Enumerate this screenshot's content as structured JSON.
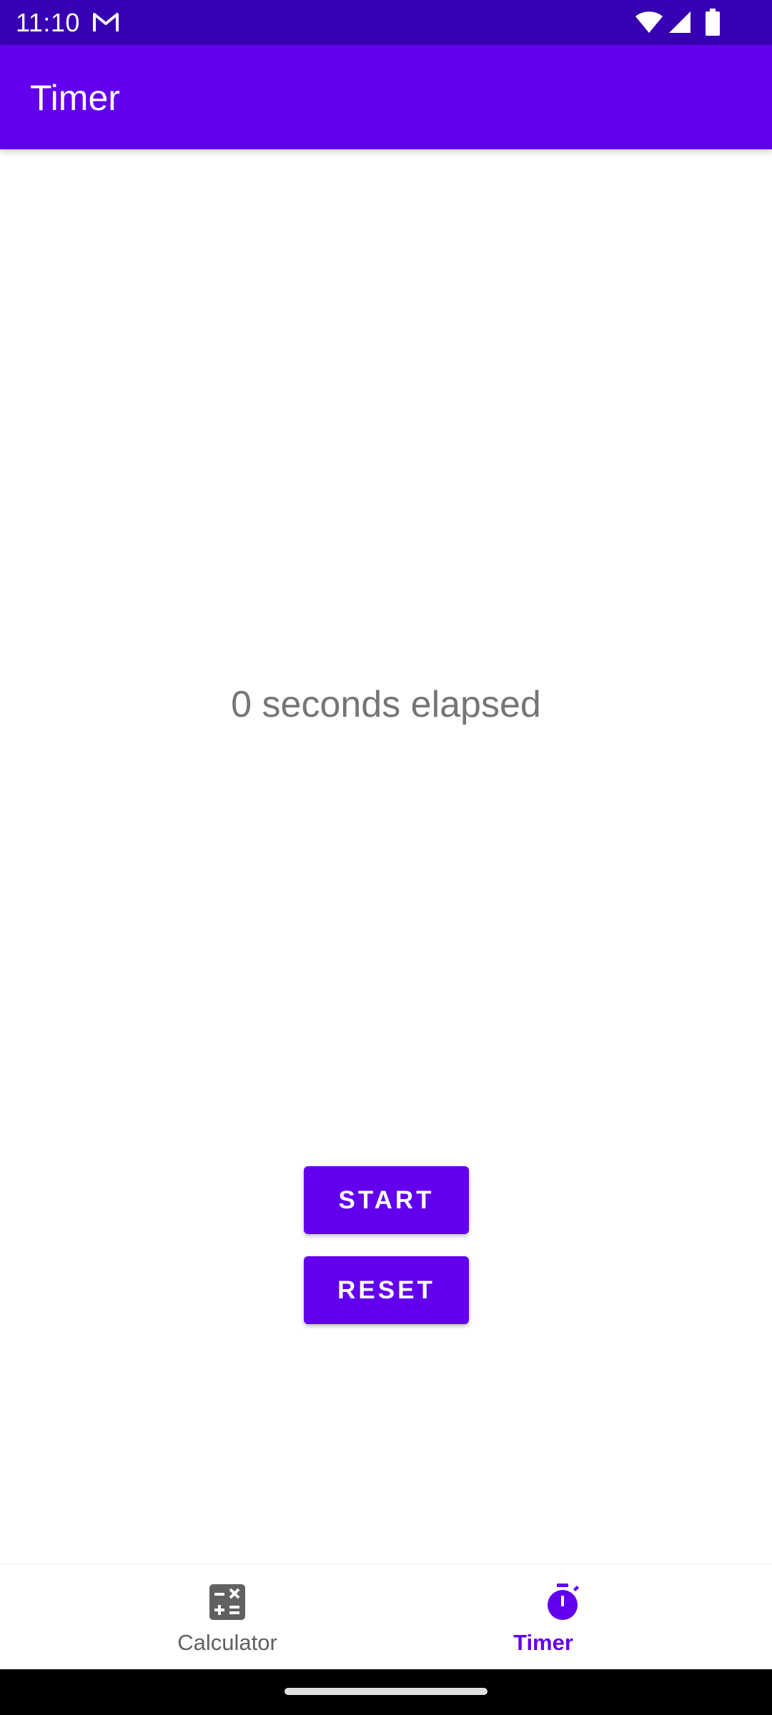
{
  "status_bar": {
    "time": "11:10",
    "icons": [
      "gmail-icon",
      "wifi-icon",
      "signal-icon",
      "battery-icon"
    ],
    "background_color": "#3700b3"
  },
  "app_bar": {
    "title": "Timer",
    "background_color": "#6200ee"
  },
  "timer": {
    "elapsed_text": "0 seconds elapsed"
  },
  "buttons": {
    "start_label": "START",
    "reset_label": "RESET",
    "color": "#6200ee"
  },
  "bottom_nav": {
    "items": [
      {
        "label": "Calculator",
        "icon": "calculator-icon",
        "selected": false
      },
      {
        "label": "Timer",
        "icon": "stopwatch-icon",
        "selected": true
      }
    ],
    "active_color": "#6200ee",
    "inactive_color": "#616161"
  }
}
